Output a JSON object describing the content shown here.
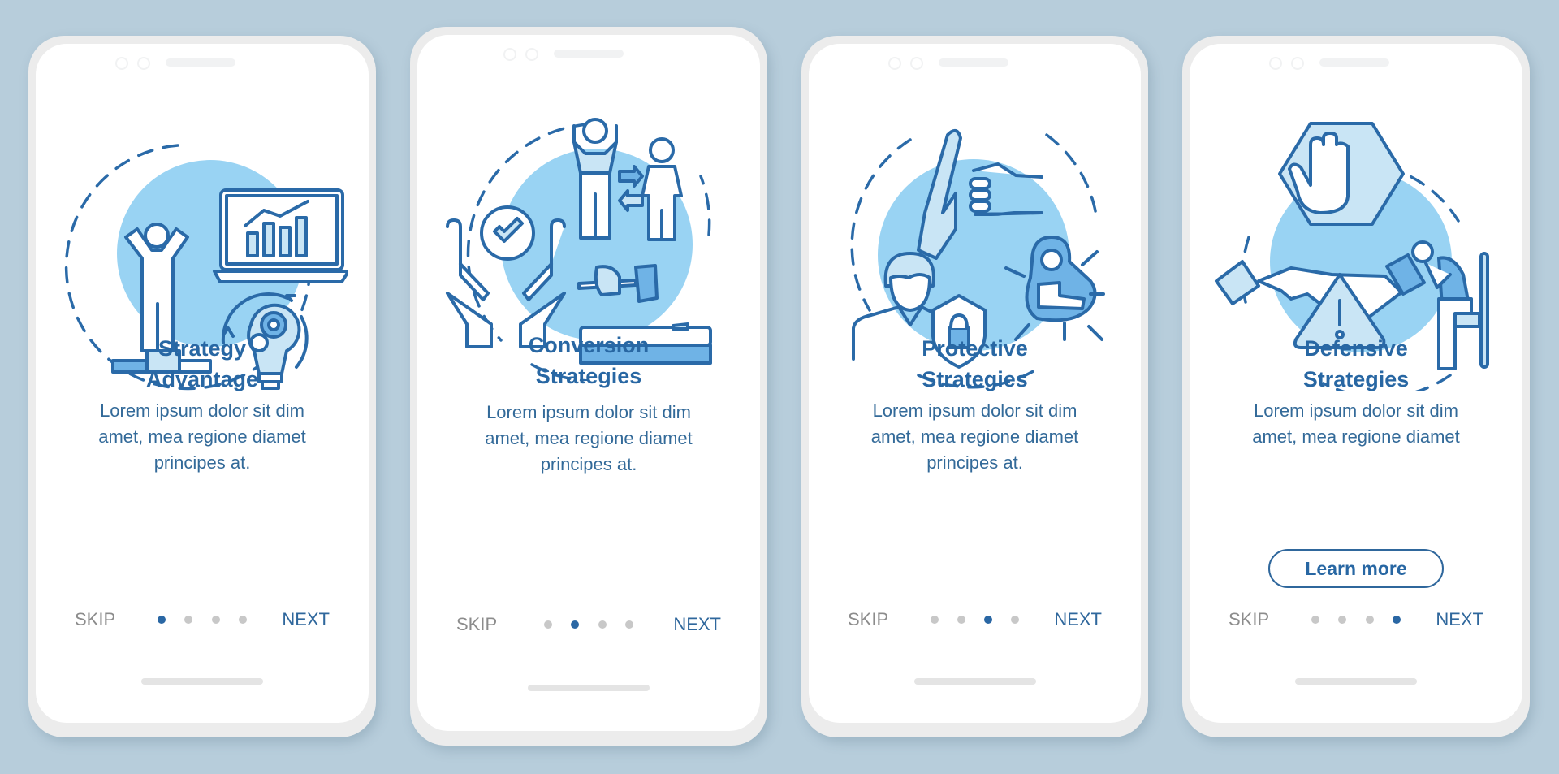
{
  "theme": {
    "background": "#b7cddb",
    "accent": "#2867a3",
    "blob": "#99d3f3",
    "inactive_dot": "#c8c8c8",
    "skip_color": "#8c8c8c"
  },
  "screens": [
    {
      "title_line1": "Strategy",
      "title_line2": "Advantage",
      "body_line1": "Lorem ipsum dolor sit dim",
      "body_line2": "amet, mea regione diamet",
      "body_line3": "principes at.",
      "illustration": "person-podium-laptop-chart-lightbulb-gears-icon",
      "skip_label": "SKIP",
      "next_label": "NEXT",
      "page_index": 1,
      "page_count": 4
    },
    {
      "title_line1": "Conversion",
      "title_line2": "Strategies",
      "body_line1": "Lorem ipsum dolor sit dim",
      "body_line2": "amet, mea regione diamet",
      "body_line3": "principes at.",
      "illustration": "hands-checkmark-people-exchange-hammer-icon",
      "skip_label": "SKIP",
      "next_label": "NEXT",
      "page_index": 2,
      "page_count": 4
    },
    {
      "title_line1": "Protective",
      "title_line2": "Strategies",
      "body_line1": "Lorem ipsum dolor sit dim",
      "body_line2": "amet, mea regione diamet",
      "body_line3": "principes at.",
      "illustration": "hand-block-fist-person-shield-lock-icon",
      "skip_label": "SKIP",
      "next_label": "NEXT",
      "page_index": 3,
      "page_count": 4
    },
    {
      "title_line1": "Defensive",
      "title_line2": "Strategies",
      "body_line1": "Lorem ipsum dolor sit dim",
      "body_line2": "amet, mea regione diamet",
      "button_label": "Learn more",
      "illustration": "stop-hand-handshake-warning-sitting-person-icon",
      "skip_label": "SKIP",
      "next_label": "NEXT",
      "page_index": 4,
      "page_count": 4
    }
  ]
}
